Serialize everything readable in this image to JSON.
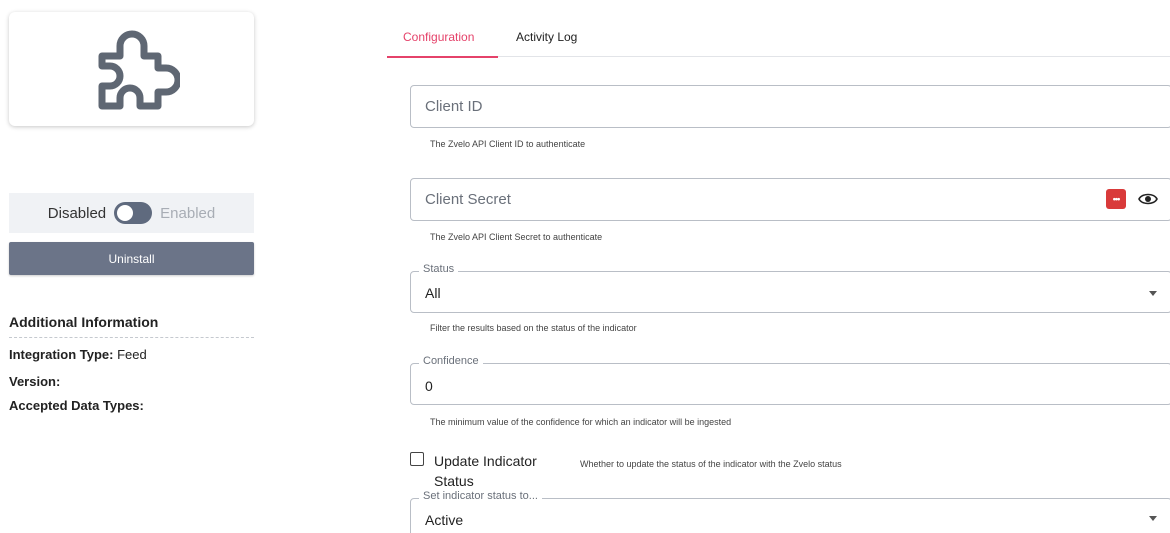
{
  "plugin": {
    "icon": "puzzle-piece-icon",
    "toggle": {
      "off_label": "Disabled",
      "on_label": "Enabled",
      "state": "disabled"
    },
    "uninstall_label": "Uninstall"
  },
  "additional_info": {
    "title": "Additional Information",
    "integration_type_label": "Integration Type:",
    "integration_type_value": "Feed",
    "version_label": "Version:",
    "accepted_data_types_label": "Accepted Data Types:"
  },
  "tabs": [
    {
      "label": "Configuration",
      "active": true
    },
    {
      "label": "Activity Log",
      "active": false
    }
  ],
  "form": {
    "client_id": {
      "placeholder": "Client ID",
      "helper": "The Zvelo API Client ID to authenticate"
    },
    "client_secret": {
      "placeholder": "Client Secret",
      "helper": "The Zvelo API Client Secret to authenticate",
      "icons": [
        "password-manager-icon",
        "eye-icon"
      ]
    },
    "status": {
      "label": "Status",
      "value": "All",
      "helper": "Filter the results based on the status of the indicator"
    },
    "confidence": {
      "label": "Confidence",
      "value": "0",
      "helper": "The minimum value of the confidence for which an indicator will be ingested"
    },
    "update_indicator_status": {
      "label": "Update Indicator Status",
      "checked": false,
      "helper": "Whether to update the status of the indicator with the Zvelo status"
    },
    "set_indicator_status": {
      "label": "Set indicator status to...",
      "value": "Active"
    }
  },
  "colors": {
    "accent": "#e5426a",
    "button": "#6b7488",
    "toggle_track": "#5f6a7e"
  }
}
